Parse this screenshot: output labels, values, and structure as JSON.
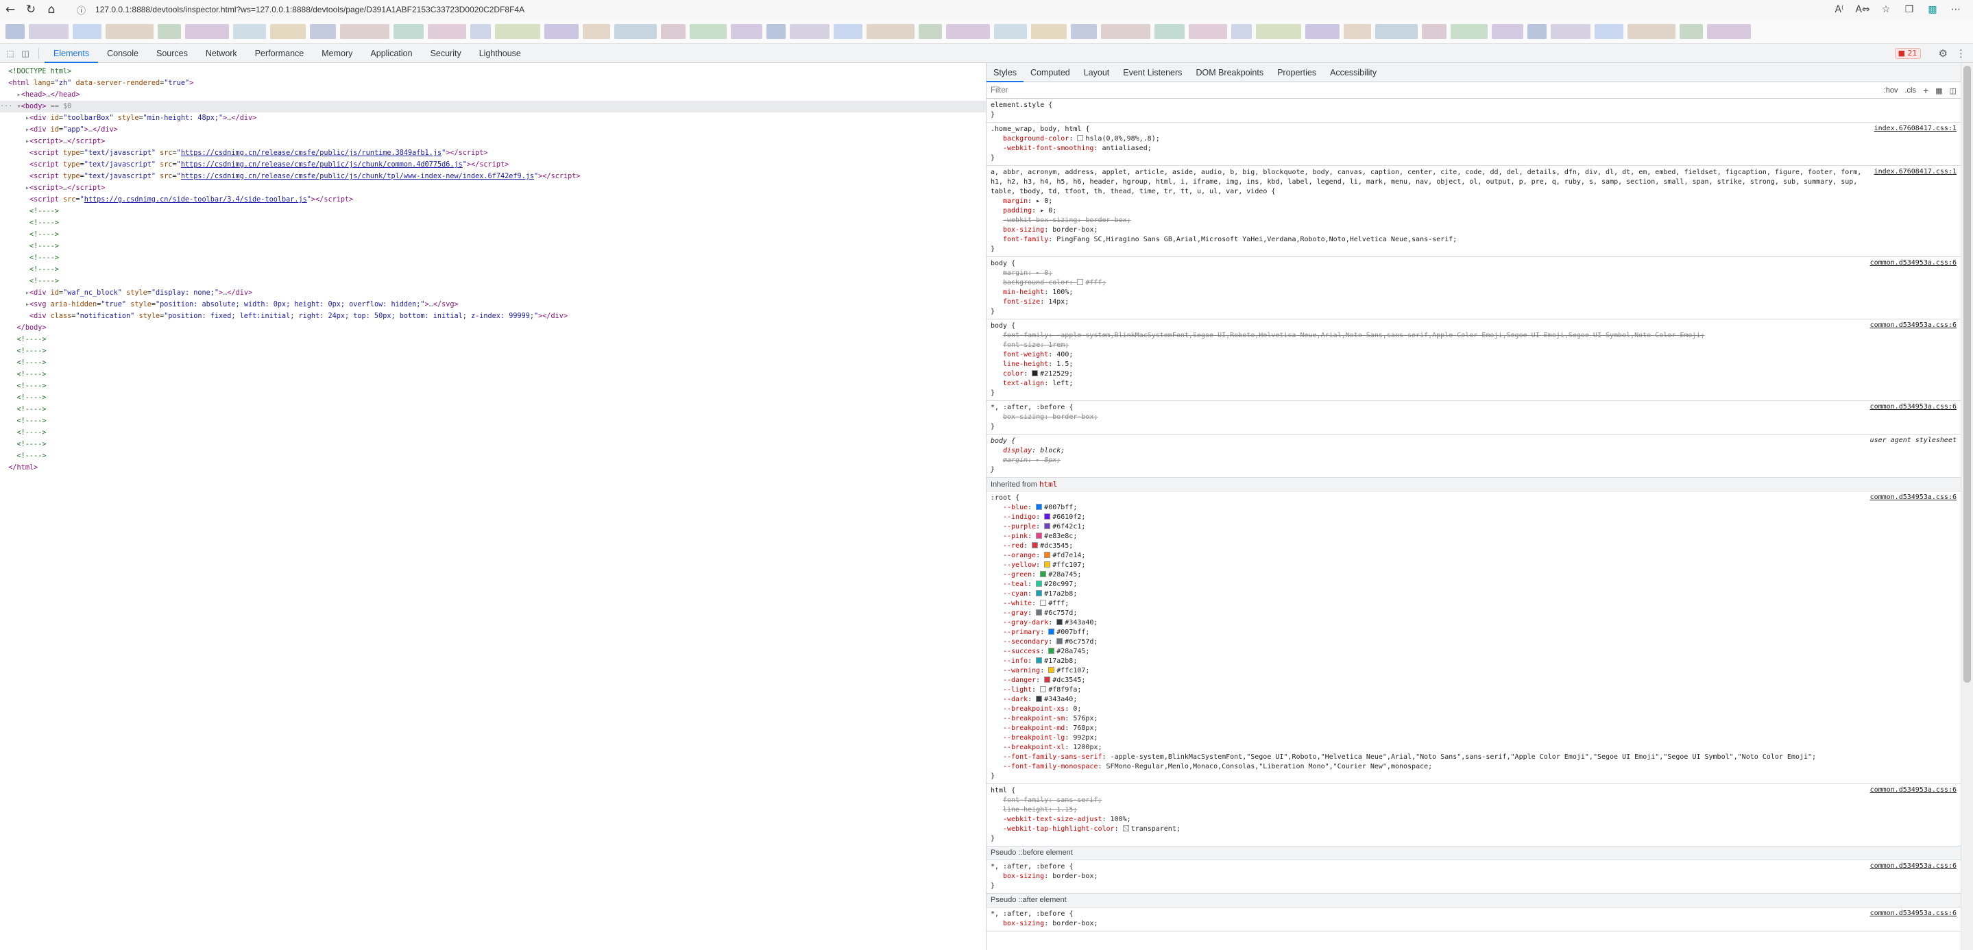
{
  "browser": {
    "url": "127.0.0.1:8888/devtools/inspector.html?ws=127.0.0.1:8888/devtools/page/D391A1ABF2153C33723D0020C2DF8F4A"
  },
  "bookmark_colors": [
    "#b9c4dd",
    "#d6d0e3",
    "#c9d6ef",
    "#e0d3c8",
    "#c8d8c6",
    "#d9c9de",
    "#cfdde6",
    "#e6d9c2",
    "#c4cbe0",
    "#ddd0cf",
    "#c2dcd3",
    "#e1ccd9",
    "#ced5e8",
    "#d8e0c4",
    "#cdc6e3",
    "#e3d6c9",
    "#c6d5df",
    "#dccbd2",
    "#c8dec9",
    "#d5c8e1"
  ],
  "devtools": {
    "tabs": [
      "Elements",
      "Console",
      "Sources",
      "Network",
      "Performance",
      "Memory",
      "Application",
      "Security",
      "Lighthouse"
    ],
    "issues_count": "21"
  },
  "elements": [
    {
      "kind": "comment",
      "text": "<!DOCTYPE html>"
    },
    {
      "kind": "raw",
      "html": "<span class='tg'>&lt;html</span> <span class='an'>lang</span>=<span class='av'>\"zh\"</span> <span class='an'>data-server-rendered</span>=<span class='av'>\"true\"</span><span class='tg'>&gt;</span>"
    }
  ],
  "styles": {
    "tabs": [
      "Styles",
      "Computed",
      "Layout",
      "Event Listeners",
      "DOM Breakpoints",
      "Properties",
      "Accessibility"
    ],
    "filter_placeholder": "Filter",
    "hov": ":hov",
    "cls": ".cls",
    "inherited_from": "Inherited from",
    "inherited_tag": "html",
    "pseudo_before": "Pseudo ::before element",
    "pseudo_after": "Pseudo ::after element",
    "root_vars": [
      {
        "n": "--blue",
        "v": "#007bff",
        "c": "#007bff"
      },
      {
        "n": "--indigo",
        "v": "#6610f2",
        "c": "#6610f2"
      },
      {
        "n": "--purple",
        "v": "#6f42c1",
        "c": "#6f42c1"
      },
      {
        "n": "--pink",
        "v": "#e83e8c",
        "c": "#e83e8c"
      },
      {
        "n": "--red",
        "v": "#dc3545",
        "c": "#dc3545"
      },
      {
        "n": "--orange",
        "v": "#fd7e14",
        "c": "#fd7e14"
      },
      {
        "n": "--yellow",
        "v": "#ffc107",
        "c": "#ffc107"
      },
      {
        "n": "--green",
        "v": "#28a745",
        "c": "#28a745"
      },
      {
        "n": "--teal",
        "v": "#20c997",
        "c": "#20c997"
      },
      {
        "n": "--cyan",
        "v": "#17a2b8",
        "c": "#17a2b8"
      },
      {
        "n": "--white",
        "v": "#fff",
        "c": "#ffffff"
      },
      {
        "n": "--gray",
        "v": "#6c757d",
        "c": "#6c757d"
      },
      {
        "n": "--gray-dark",
        "v": "#343a40",
        "c": "#343a40"
      },
      {
        "n": "--primary",
        "v": "#007bff",
        "c": "#007bff"
      },
      {
        "n": "--secondary",
        "v": "#6c757d",
        "c": "#6c757d"
      },
      {
        "n": "--success",
        "v": "#28a745",
        "c": "#28a745"
      },
      {
        "n": "--info",
        "v": "#17a2b8",
        "c": "#17a2b8"
      },
      {
        "n": "--warning",
        "v": "#ffc107",
        "c": "#ffc107"
      },
      {
        "n": "--danger",
        "v": "#dc3545",
        "c": "#dc3545"
      },
      {
        "n": "--light",
        "v": "#f8f9fa",
        "c": "#f8f9fa"
      },
      {
        "n": "--dark",
        "v": "#343a40",
        "c": "#343a40"
      },
      {
        "n": "--breakpoint-xs",
        "v": "0;",
        "c": ""
      },
      {
        "n": "--breakpoint-sm",
        "v": "576px;",
        "c": ""
      },
      {
        "n": "--breakpoint-md",
        "v": "768px;",
        "c": ""
      },
      {
        "n": "--breakpoint-lg",
        "v": "992px;",
        "c": ""
      },
      {
        "n": "--breakpoint-xl",
        "v": "1200px;",
        "c": ""
      },
      {
        "n": "--font-family-sans-serif",
        "v": "-apple-system,BlinkMacSystemFont,\"Segoe UI\",Roboto,\"Helvetica Neue\",Arial,\"Noto Sans\",sans-serif,\"Apple Color Emoji\",\"Segoe UI Emoji\",\"Segoe UI Symbol\",\"Noto Color Emoji\";",
        "c": ""
      },
      {
        "n": "--font-family-monospace",
        "v": "SFMono-Regular,Menlo,Monaco,Consolas,\"Liberation Mono\",\"Courier New\",monospace;",
        "c": ""
      }
    ]
  }
}
